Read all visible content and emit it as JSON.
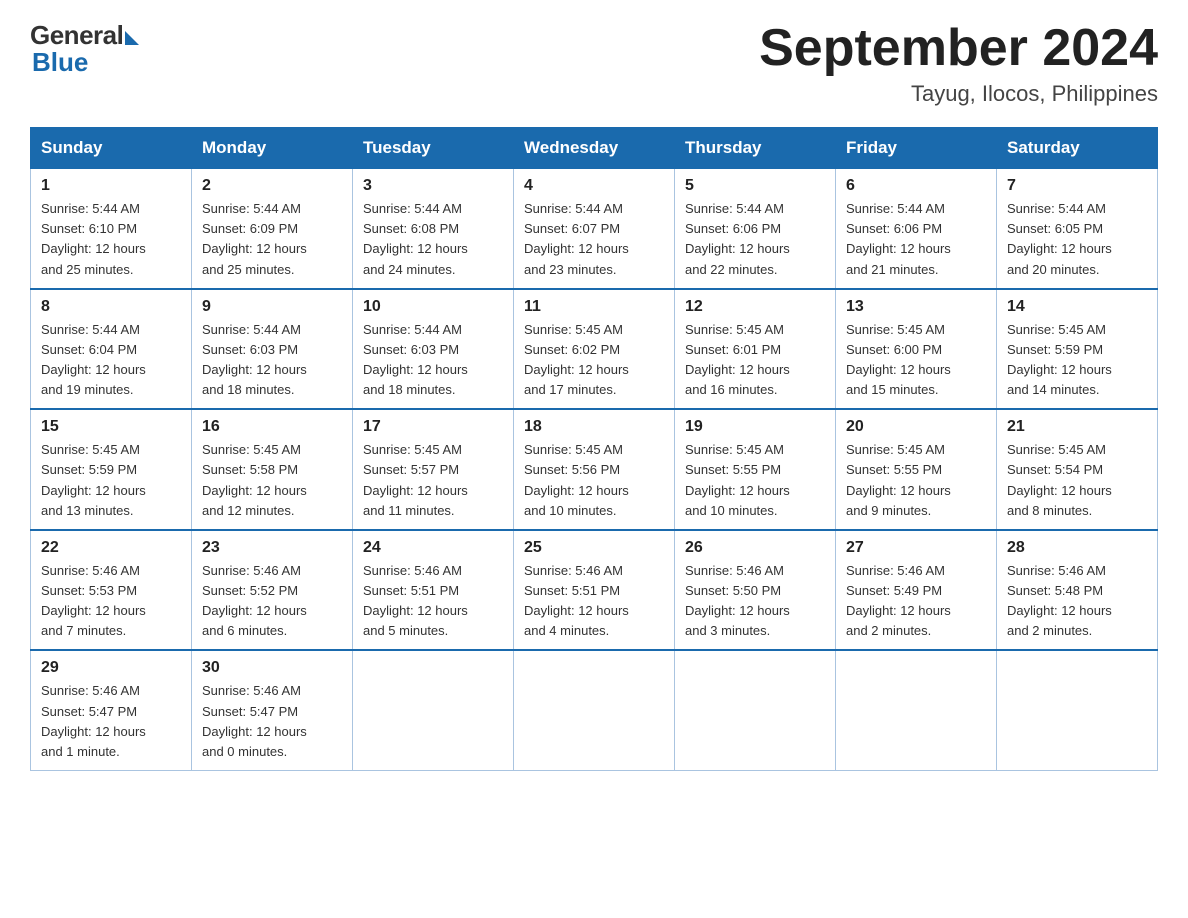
{
  "header": {
    "logo_general": "General",
    "logo_blue": "Blue",
    "month_title": "September 2024",
    "location": "Tayug, Ilocos, Philippines"
  },
  "weekdays": [
    "Sunday",
    "Monday",
    "Tuesday",
    "Wednesday",
    "Thursday",
    "Friday",
    "Saturday"
  ],
  "weeks": [
    [
      {
        "day": "1",
        "sunrise": "5:44 AM",
        "sunset": "6:10 PM",
        "daylight": "12 hours and 25 minutes."
      },
      {
        "day": "2",
        "sunrise": "5:44 AM",
        "sunset": "6:09 PM",
        "daylight": "12 hours and 25 minutes."
      },
      {
        "day": "3",
        "sunrise": "5:44 AM",
        "sunset": "6:08 PM",
        "daylight": "12 hours and 24 minutes."
      },
      {
        "day": "4",
        "sunrise": "5:44 AM",
        "sunset": "6:07 PM",
        "daylight": "12 hours and 23 minutes."
      },
      {
        "day": "5",
        "sunrise": "5:44 AM",
        "sunset": "6:06 PM",
        "daylight": "12 hours and 22 minutes."
      },
      {
        "day": "6",
        "sunrise": "5:44 AM",
        "sunset": "6:06 PM",
        "daylight": "12 hours and 21 minutes."
      },
      {
        "day": "7",
        "sunrise": "5:44 AM",
        "sunset": "6:05 PM",
        "daylight": "12 hours and 20 minutes."
      }
    ],
    [
      {
        "day": "8",
        "sunrise": "5:44 AM",
        "sunset": "6:04 PM",
        "daylight": "12 hours and 19 minutes."
      },
      {
        "day": "9",
        "sunrise": "5:44 AM",
        "sunset": "6:03 PM",
        "daylight": "12 hours and 18 minutes."
      },
      {
        "day": "10",
        "sunrise": "5:44 AM",
        "sunset": "6:03 PM",
        "daylight": "12 hours and 18 minutes."
      },
      {
        "day": "11",
        "sunrise": "5:45 AM",
        "sunset": "6:02 PM",
        "daylight": "12 hours and 17 minutes."
      },
      {
        "day": "12",
        "sunrise": "5:45 AM",
        "sunset": "6:01 PM",
        "daylight": "12 hours and 16 minutes."
      },
      {
        "day": "13",
        "sunrise": "5:45 AM",
        "sunset": "6:00 PM",
        "daylight": "12 hours and 15 minutes."
      },
      {
        "day": "14",
        "sunrise": "5:45 AM",
        "sunset": "5:59 PM",
        "daylight": "12 hours and 14 minutes."
      }
    ],
    [
      {
        "day": "15",
        "sunrise": "5:45 AM",
        "sunset": "5:59 PM",
        "daylight": "12 hours and 13 minutes."
      },
      {
        "day": "16",
        "sunrise": "5:45 AM",
        "sunset": "5:58 PM",
        "daylight": "12 hours and 12 minutes."
      },
      {
        "day": "17",
        "sunrise": "5:45 AM",
        "sunset": "5:57 PM",
        "daylight": "12 hours and 11 minutes."
      },
      {
        "day": "18",
        "sunrise": "5:45 AM",
        "sunset": "5:56 PM",
        "daylight": "12 hours and 10 minutes."
      },
      {
        "day": "19",
        "sunrise": "5:45 AM",
        "sunset": "5:55 PM",
        "daylight": "12 hours and 10 minutes."
      },
      {
        "day": "20",
        "sunrise": "5:45 AM",
        "sunset": "5:55 PM",
        "daylight": "12 hours and 9 minutes."
      },
      {
        "day": "21",
        "sunrise": "5:45 AM",
        "sunset": "5:54 PM",
        "daylight": "12 hours and 8 minutes."
      }
    ],
    [
      {
        "day": "22",
        "sunrise": "5:46 AM",
        "sunset": "5:53 PM",
        "daylight": "12 hours and 7 minutes."
      },
      {
        "day": "23",
        "sunrise": "5:46 AM",
        "sunset": "5:52 PM",
        "daylight": "12 hours and 6 minutes."
      },
      {
        "day": "24",
        "sunrise": "5:46 AM",
        "sunset": "5:51 PM",
        "daylight": "12 hours and 5 minutes."
      },
      {
        "day": "25",
        "sunrise": "5:46 AM",
        "sunset": "5:51 PM",
        "daylight": "12 hours and 4 minutes."
      },
      {
        "day": "26",
        "sunrise": "5:46 AM",
        "sunset": "5:50 PM",
        "daylight": "12 hours and 3 minutes."
      },
      {
        "day": "27",
        "sunrise": "5:46 AM",
        "sunset": "5:49 PM",
        "daylight": "12 hours and 2 minutes."
      },
      {
        "day": "28",
        "sunrise": "5:46 AM",
        "sunset": "5:48 PM",
        "daylight": "12 hours and 2 minutes."
      }
    ],
    [
      {
        "day": "29",
        "sunrise": "5:46 AM",
        "sunset": "5:47 PM",
        "daylight": "12 hours and 1 minute."
      },
      {
        "day": "30",
        "sunrise": "5:46 AM",
        "sunset": "5:47 PM",
        "daylight": "12 hours and 0 minutes."
      },
      null,
      null,
      null,
      null,
      null
    ]
  ],
  "labels": {
    "sunrise": "Sunrise:",
    "sunset": "Sunset:",
    "daylight": "Daylight:"
  }
}
